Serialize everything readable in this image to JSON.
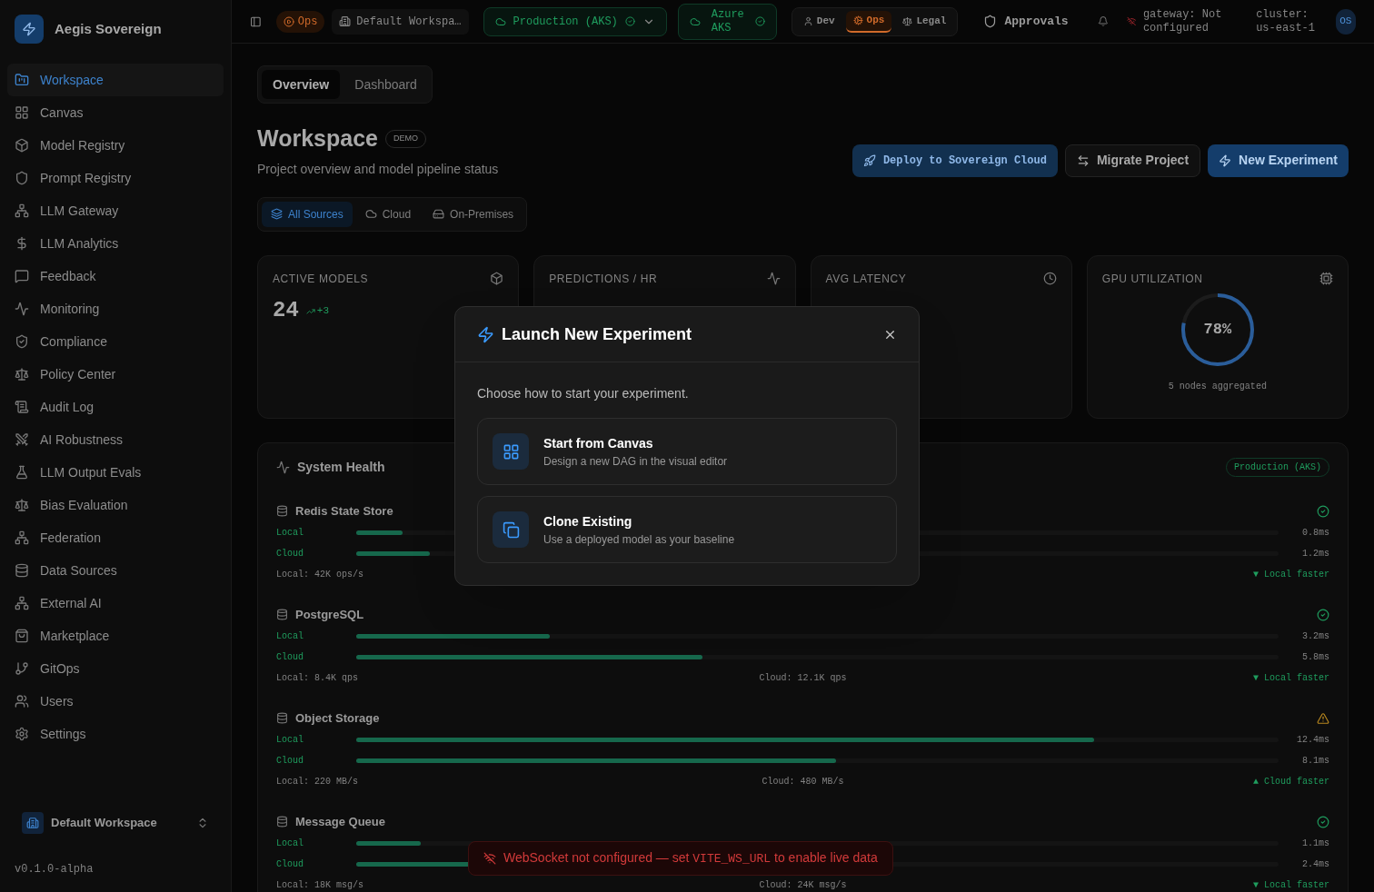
{
  "sidebar": {
    "brand": "Aegis Sovereign",
    "items": [
      {
        "label": "Workspace",
        "selected": true
      },
      {
        "label": "Canvas",
        "selected": false
      },
      {
        "label": "Model Registry",
        "selected": false
      },
      {
        "label": "Prompt Registry",
        "selected": false
      },
      {
        "label": "LLM Gateway",
        "selected": false
      },
      {
        "label": "LLM Analytics",
        "selected": false
      },
      {
        "label": "Feedback",
        "selected": false
      },
      {
        "label": "Monitoring",
        "selected": false
      },
      {
        "label": "Compliance",
        "selected": false
      },
      {
        "label": "Policy Center",
        "selected": false
      },
      {
        "label": "Audit Log",
        "selected": false
      },
      {
        "label": "AI Robustness",
        "selected": false
      },
      {
        "label": "LLM Output Evals",
        "selected": false
      },
      {
        "label": "Bias Evaluation",
        "selected": false
      },
      {
        "label": "Federation",
        "selected": false
      },
      {
        "label": "Data Sources",
        "selected": false
      },
      {
        "label": "External AI",
        "selected": false
      },
      {
        "label": "Marketplace",
        "selected": false
      },
      {
        "label": "GitOps",
        "selected": false
      },
      {
        "label": "Users",
        "selected": false
      },
      {
        "label": "Settings",
        "selected": false
      }
    ],
    "workspace": "Default Workspace",
    "version": "v0.1.0-alpha"
  },
  "topbar": {
    "mode_badge": "Ops",
    "workspace": "Default Workspa…",
    "environment": "Production (AKS)",
    "cluster_badge": "Azure AKS",
    "personas": [
      {
        "label": "Dev",
        "selected": false
      },
      {
        "label": "Ops",
        "selected": true
      },
      {
        "label": "Legal",
        "selected": false
      }
    ],
    "approvals": "Approvals",
    "gateway": "gateway: Not configured",
    "cluster": "cluster: us-east-1",
    "avatar": "OS"
  },
  "tabs": [
    {
      "label": "Overview",
      "selected": true
    },
    {
      "label": "Dashboard",
      "selected": false
    }
  ],
  "header": {
    "title": "Workspace",
    "badge": "DEMO",
    "subtitle": "Project overview and model pipeline status",
    "actions": [
      {
        "label": "Deploy to Sovereign Cloud",
        "kind": "deploy"
      },
      {
        "label": "Migrate Project",
        "kind": "secondary"
      },
      {
        "label": "New Experiment",
        "kind": "primary"
      }
    ]
  },
  "source_filters": [
    {
      "label": "All Sources",
      "selected": true
    },
    {
      "label": "Cloud",
      "selected": false
    },
    {
      "label": "On-Premises",
      "selected": false
    }
  ],
  "stats": [
    {
      "kind": "number",
      "label": "ACTIVE MODELS",
      "value": "24",
      "delta": "+3"
    },
    {
      "kind": "number",
      "label": "PREDICTIONS / HR"
    },
    {
      "kind": "number",
      "label": "AVG LATENCY"
    },
    {
      "kind": "gauge",
      "label": "GPU UTILIZATION",
      "level": 0.78,
      "value": "78%",
      "note": "5 nodes aggregated"
    }
  ],
  "health": {
    "title": "System Health",
    "environment": "Production (AKS)",
    "services": [
      {
        "name": "Redis State Store",
        "healthy": true,
        "rows": [
          {
            "label": "Local",
            "level": 0.05,
            "reading": "0.8ms"
          },
          {
            "label": "Cloud",
            "level": 0.08,
            "reading": "1.2ms"
          }
        ],
        "local_stat": "Local: 42K ops/s",
        "verdict": "▼ Local faster"
      },
      {
        "name": "PostgreSQL",
        "healthy": true,
        "rows": [
          {
            "label": "Local",
            "level": 0.21,
            "reading": "3.2ms"
          },
          {
            "label": "Cloud",
            "level": 0.375,
            "reading": "5.8ms"
          }
        ],
        "local_stat": "Local: 8.4K qps",
        "cloud_stat": "Cloud: 12.1K qps",
        "verdict": "▼ Local faster"
      },
      {
        "name": "Object Storage",
        "healthy": false,
        "rows": [
          {
            "label": "Local",
            "level": 0.8,
            "reading": "12.4ms"
          },
          {
            "label": "Cloud",
            "level": 0.52,
            "reading": "8.1ms"
          }
        ],
        "local_stat": "Local: 220 MB/s",
        "cloud_stat": "Cloud: 480 MB/s",
        "verdict": "▲ Cloud faster"
      },
      {
        "name": "Message Queue",
        "healthy": true,
        "rows": [
          {
            "label": "Local",
            "level": 0.07,
            "reading": "1.1ms"
          },
          {
            "label": "Cloud",
            "level": 0.155,
            "reading": "2.4ms"
          }
        ],
        "local_stat": "Local: 18K msg/s",
        "cloud_stat": "Cloud: 24K msg/s",
        "verdict": "▼ Local faster"
      }
    ]
  },
  "toast": {
    "before": "WebSocket not configured — set",
    "code": "VITE_WS_URL",
    "after": "to enable live data"
  },
  "dialog": {
    "title": "Launch New Experiment",
    "description": "Choose how to start your experiment.",
    "options": [
      {
        "title": "Start from Canvas",
        "description": "Design a new DAG in the visual editor"
      },
      {
        "title": "Clone Existing",
        "description": "Use a deployed model as your baseline"
      }
    ]
  }
}
